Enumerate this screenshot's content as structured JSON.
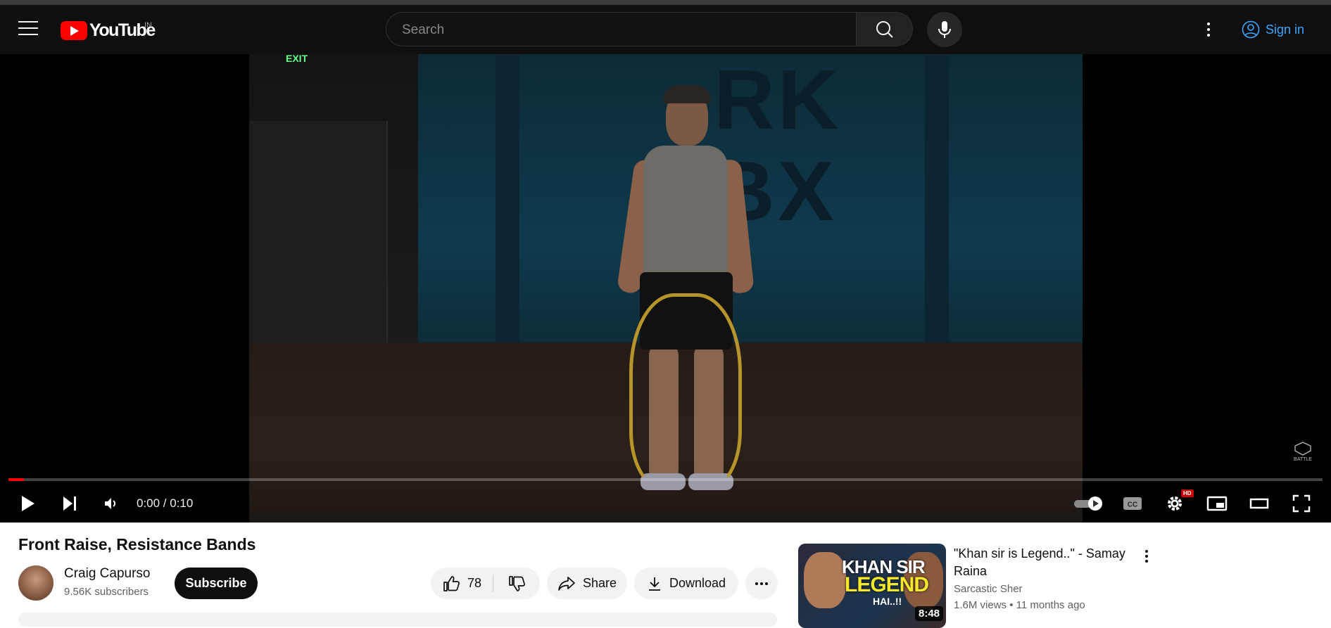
{
  "header": {
    "logo_text": "YouTube",
    "region": "IN",
    "search_placeholder": "Search",
    "signin_label": "Sign in"
  },
  "player": {
    "time": "0:00 / 0:10",
    "progress": 0.012,
    "hd_badge": "HD",
    "watermark": "BATTLE",
    "wall_letters": "RK\nBX",
    "exit_sign": "EXIT"
  },
  "video": {
    "title": "Front Raise, Resistance Bands",
    "channel_name": "Craig Capurso",
    "subscribers": "9.56K subscribers",
    "subscribe_label": "Subscribe",
    "likes": "78",
    "share_label": "Share",
    "download_label": "Download"
  },
  "recommendation": {
    "title": "\"Khan sir is Legend..\" - Samay Raina",
    "channel": "Sarcastic Sher",
    "views": "1.6M views",
    "age": "11 months ago",
    "duration": "8:48",
    "thumb_line1": "KHAN SIR",
    "thumb_line2": "LEGEND",
    "thumb_line3": "HAI..!!"
  },
  "colors": {
    "accent": "#ff0000",
    "link": "#3ea6ff",
    "masthead_bg": "#0f0f0f"
  }
}
